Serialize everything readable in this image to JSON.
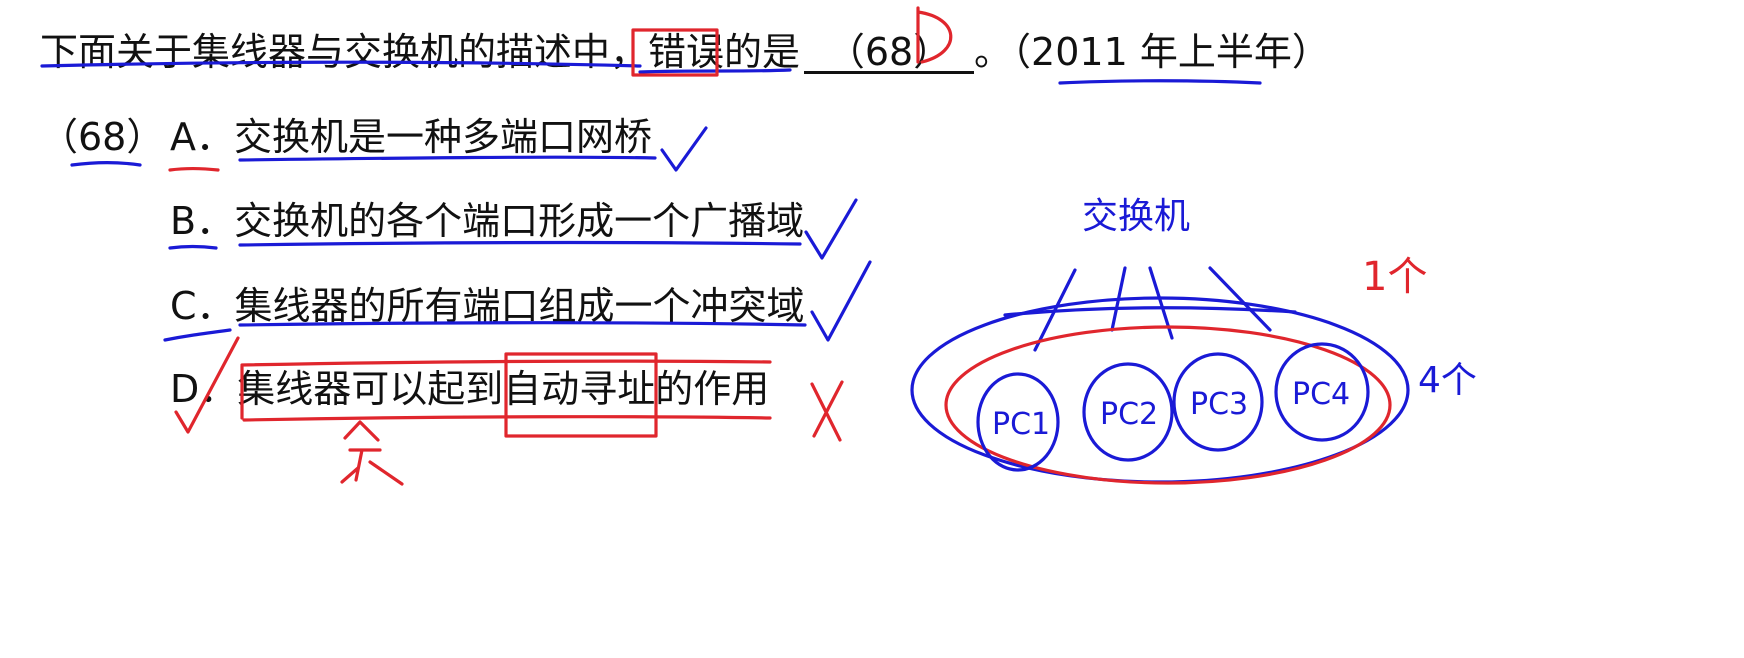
{
  "question": {
    "prefix": "下面关于集线器与交换机的描述中，",
    "keyword": "错误",
    "middle": "的是",
    "blank": "（68）",
    "suffix": "。（2011 年上半年）"
  },
  "question_number": "（68）",
  "options": [
    {
      "letter": "A．",
      "text": "交换机是一种多端口网桥"
    },
    {
      "letter": "B．",
      "text": "交换机的各个端口形成一个广播域"
    },
    {
      "letter": "C．",
      "text": "集线器的所有端口组成一个冲突域"
    },
    {
      "letter": "D．",
      "text_a": "集线器可以起到",
      "text_boxed": "自动寻址",
      "text_b": "的作用"
    }
  ],
  "annotations": {
    "answer": "D",
    "switch_label": "交换机",
    "pcs": [
      "PC1",
      "PC2",
      "PC3",
      "PC4"
    ],
    "one_label": "1个",
    "four_label": "4个",
    "check": "✓",
    "cross": "X",
    "no_mark": "不"
  },
  "colors": {
    "text": "#111111",
    "blue_ink": "#1a1ad6",
    "red_ink": "#e0262d"
  }
}
